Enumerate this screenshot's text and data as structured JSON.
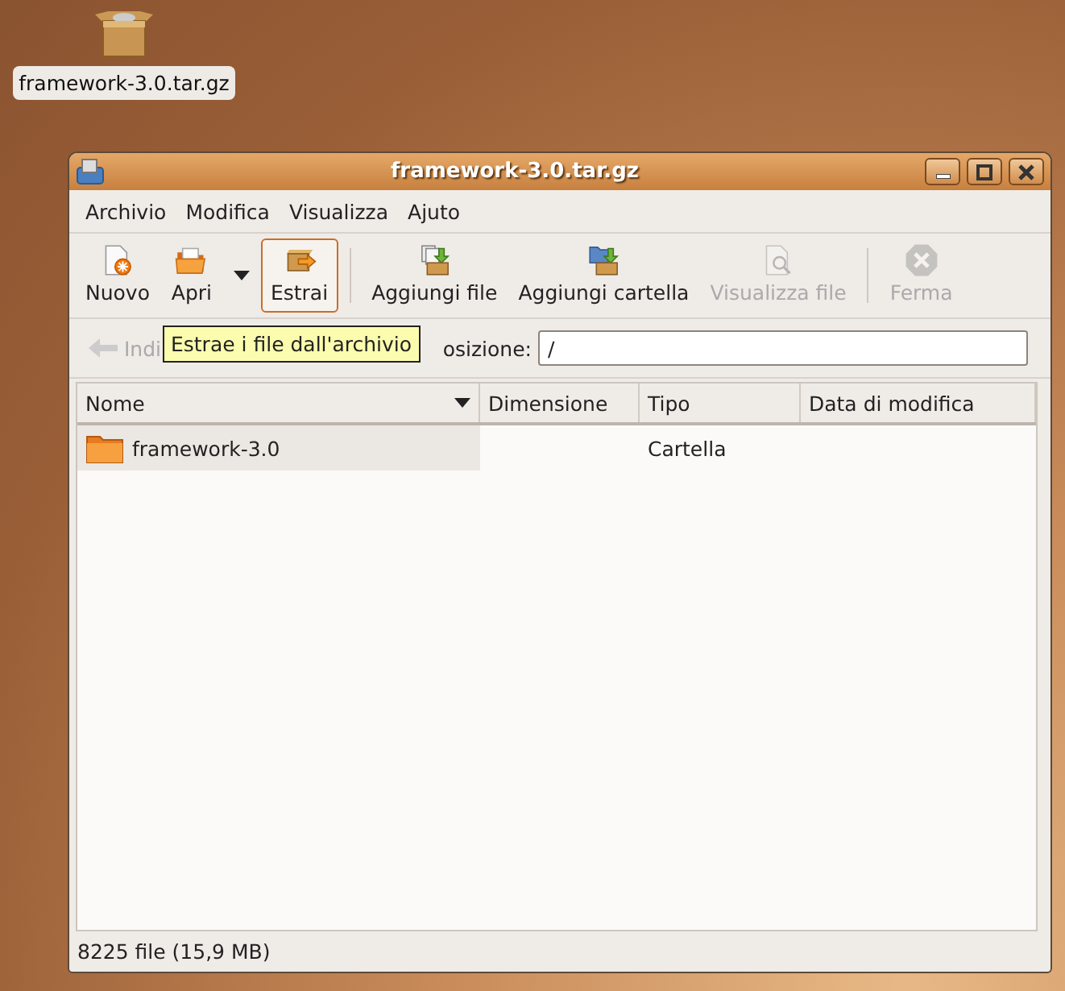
{
  "desktop_icon": {
    "label": "framework-3.0.tar.gz"
  },
  "window": {
    "title": "framework-3.0.tar.gz"
  },
  "menu": [
    "Archivio",
    "Modifica",
    "Visualizza",
    "Ajuto"
  ],
  "toolbar": [
    {
      "kind": "button",
      "label": "Nuovo",
      "disabled": false,
      "hover": false
    },
    {
      "kind": "button",
      "label": "Apri",
      "disabled": false,
      "hover": false
    },
    {
      "kind": "dropdown"
    },
    {
      "kind": "button",
      "label": "Estrai",
      "disabled": false,
      "hover": true
    },
    {
      "kind": "separator"
    },
    {
      "kind": "button",
      "label": "Aggiungi file",
      "disabled": false,
      "hover": false
    },
    {
      "kind": "button",
      "label": "Aggiungi cartella",
      "disabled": false,
      "hover": false
    },
    {
      "kind": "button",
      "label": "Visualizza file",
      "disabled": true,
      "hover": false
    },
    {
      "kind": "separator"
    },
    {
      "kind": "button",
      "label": "Ferma",
      "disabled": true,
      "hover": false
    }
  ],
  "location_bar": {
    "back_label": "Indi",
    "location_label": "osizione:",
    "value": "/"
  },
  "tooltip": "Estrae i file dall'archivio",
  "table": {
    "columns": [
      {
        "label": "Nome",
        "sorted": true
      },
      {
        "label": "Dimensione",
        "sorted": false
      },
      {
        "label": "Tipo",
        "sorted": false
      },
      {
        "label": "Data di modifica",
        "sorted": false
      }
    ],
    "rows": [
      {
        "name": "framework-3.0",
        "type": "Cartella"
      }
    ]
  },
  "status_bar": "8225 file (15,9 MB)"
}
